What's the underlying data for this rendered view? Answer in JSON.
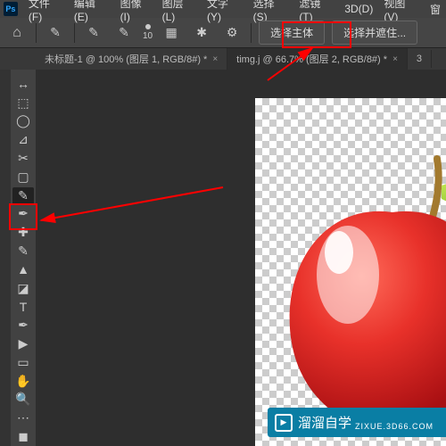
{
  "menu": {
    "items": [
      "文件(F)",
      "编辑(E)",
      "图像(I)",
      "图层(L)",
      "文字(Y)",
      "选择(S)",
      "滤镜(T)",
      "3D(D)",
      "视图(V)",
      "窗"
    ]
  },
  "optbar": {
    "brush_size": "10",
    "select_subject": "选择主体",
    "select_mask": "选择并遮住..."
  },
  "tabs": [
    {
      "label": "未标题-1 @ 100% (图层 1, RGB/8#) *",
      "active": false
    },
    {
      "label": "timg.j  @ 66.7% (图层 2, RGB/8#) *",
      "active": true
    },
    {
      "label": "3",
      "active": false
    }
  ],
  "watermark": {
    "brand": "溜溜自学",
    "domain": "ZIXUE.3D66.COM"
  },
  "tool_icons": [
    "↔",
    "⬚",
    "◯",
    "⊿",
    "✎",
    "◔",
    "✂",
    "✱",
    "⌒",
    "✏",
    "▭",
    "◑",
    "T",
    "▶",
    "▷",
    "✋",
    "🔍",
    "⬚",
    "◐",
    "▦"
  ]
}
